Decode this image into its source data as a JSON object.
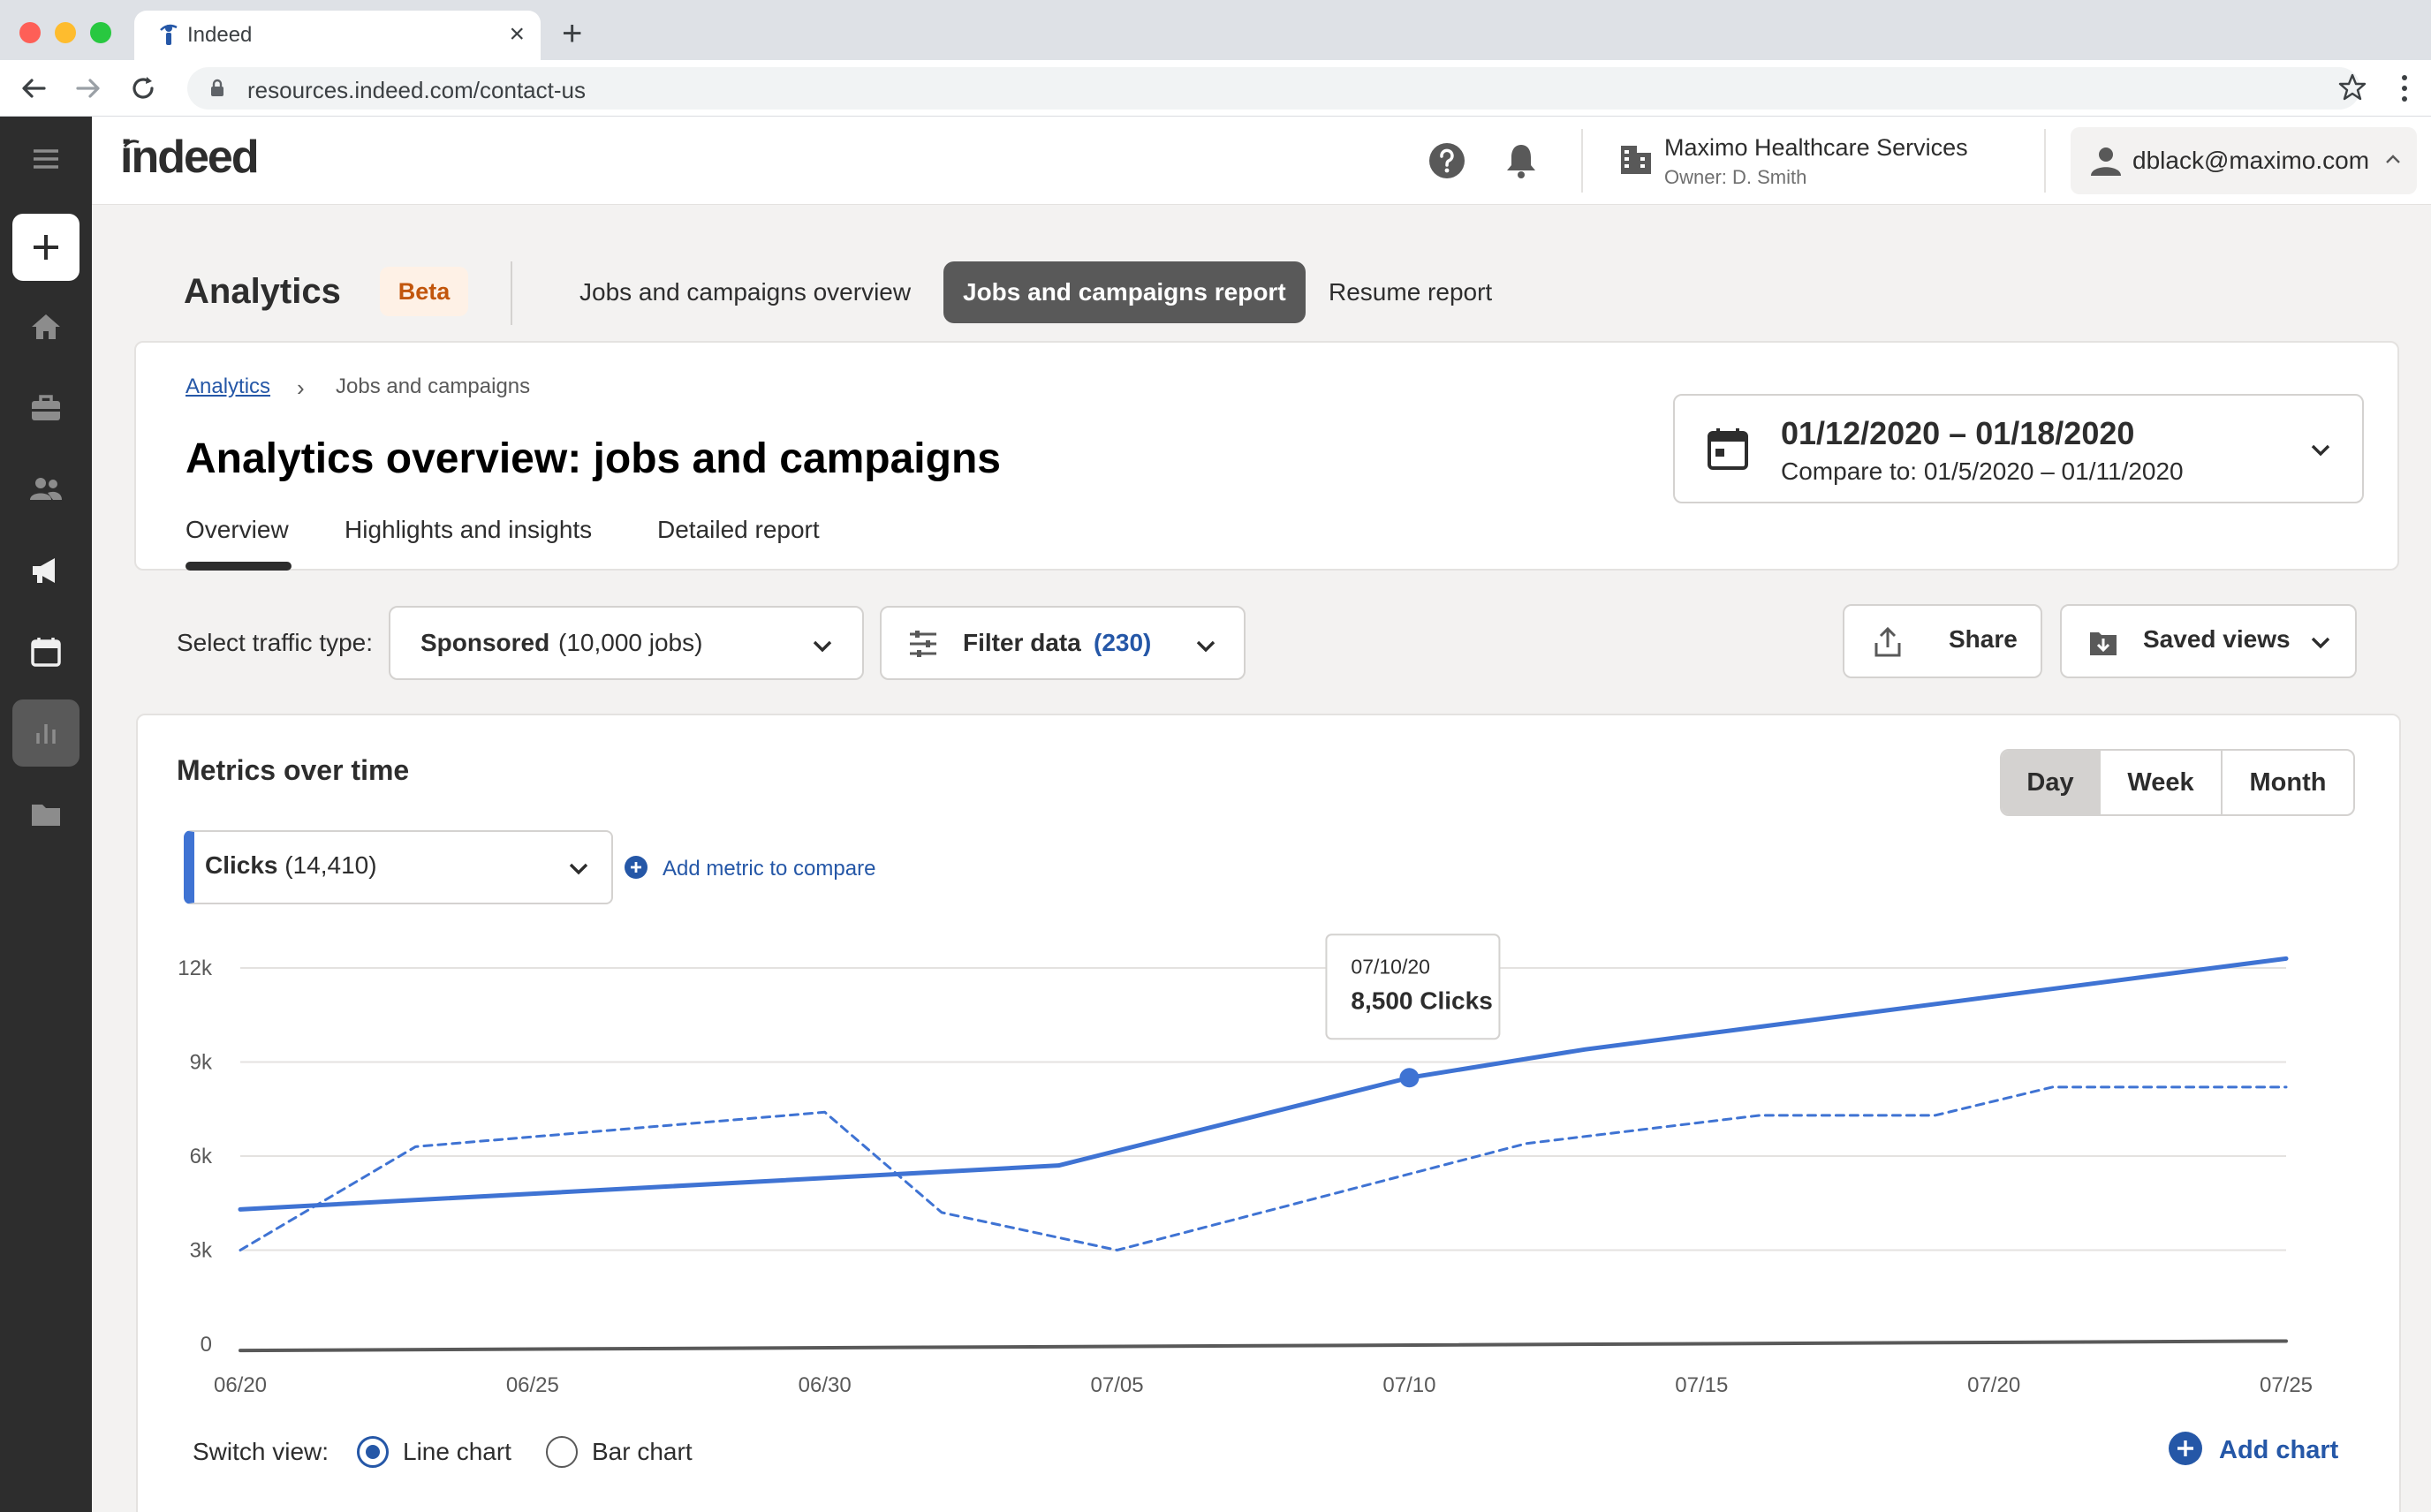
{
  "browser": {
    "tab_title": "Indeed",
    "tab_close": "×",
    "new_tab": "+",
    "url": "resources.indeed.com/contact-us"
  },
  "header": {
    "logo_text": "indeed",
    "company_name": "Maximo Healthcare Services",
    "company_owner": "Owner: D. Smith",
    "user_email": "dblack@maximo.com"
  },
  "analytics_nav": {
    "title": "Analytics",
    "badge": "Beta",
    "tabs": [
      {
        "label": "Jobs and campaigns overview",
        "active": false
      },
      {
        "label": "Jobs and campaigns report",
        "active": true
      },
      {
        "label": "Resume report",
        "active": false
      }
    ]
  },
  "overview": {
    "breadcrumb_link": "Analytics",
    "breadcrumb_sep": "›",
    "breadcrumb_current": "Jobs and campaigns",
    "title": "Analytics overview: jobs and campaigns",
    "sub_tabs": [
      "Overview",
      "Highlights and insights",
      "Detailed report"
    ],
    "date_range": "01/12/2020 – 01/18/2020",
    "compare_to": "Compare to: 01/5/2020 – 01/11/2020"
  },
  "filters": {
    "traffic_label": "Select traffic type:",
    "traffic_value": "Sponsored",
    "traffic_count": "(10,000 jobs)",
    "filter_label": "Filter data",
    "filter_count": "(230)",
    "share_label": "Share",
    "saved_views_label": "Saved views"
  },
  "metrics": {
    "title": "Metrics over time",
    "granularity": [
      {
        "label": "Day",
        "active": true
      },
      {
        "label": "Week",
        "active": false
      },
      {
        "label": "Month",
        "active": false
      }
    ],
    "metric_name": "Clicks",
    "metric_total": "(14,410)",
    "add_metric": "Add metric to compare",
    "switch_label": "Switch view:",
    "view_line": "Line chart",
    "view_bar": "Bar chart",
    "add_chart": "Add chart"
  },
  "colors": {
    "accent_blue": "#3f73d3",
    "link_blue": "#2557a7",
    "beta_orange": "#c2560c"
  },
  "chart_data": {
    "type": "line",
    "title": "",
    "xlabel": "",
    "ylabel": "",
    "x_ticks": [
      "06/20",
      "06/25",
      "06/30",
      "07/05",
      "07/10",
      "07/15",
      "07/20",
      "07/25"
    ],
    "y_ticks": [
      "0",
      "3k",
      "6k",
      "9k",
      "12k"
    ],
    "ylim": [
      0,
      12000
    ],
    "grid": true,
    "series": [
      {
        "style": "solid",
        "points": [
          {
            "x": "06/20",
            "y": 4300
          },
          {
            "x": "07/04",
            "y": 5700
          },
          {
            "x": "07/10",
            "y": 8500
          },
          {
            "x": "07/13",
            "y": 9400
          },
          {
            "x": "07/25",
            "y": 12300
          }
        ]
      },
      {
        "style": "dashed",
        "points": [
          {
            "x": "06/20",
            "y": 3000
          },
          {
            "x": "06/23",
            "y": 6300
          },
          {
            "x": "06/30",
            "y": 7400
          },
          {
            "x": "07/02",
            "y": 4200
          },
          {
            "x": "07/05",
            "y": 3000
          },
          {
            "x": "07/12",
            "y": 6400
          },
          {
            "x": "07/16",
            "y": 7300
          },
          {
            "x": "07/19",
            "y": 7300
          },
          {
            "x": "07/21",
            "y": 8200
          },
          {
            "x": "07/25",
            "y": 8200
          }
        ]
      },
      {
        "style": "baseline",
        "points": [
          {
            "x": "06/20",
            "y": -200
          },
          {
            "x": "07/25",
            "y": 100
          }
        ]
      }
    ],
    "tooltip": {
      "date": "07/10/20",
      "value": "8,500 Clicks",
      "x": "07/10",
      "y": 8500
    }
  }
}
